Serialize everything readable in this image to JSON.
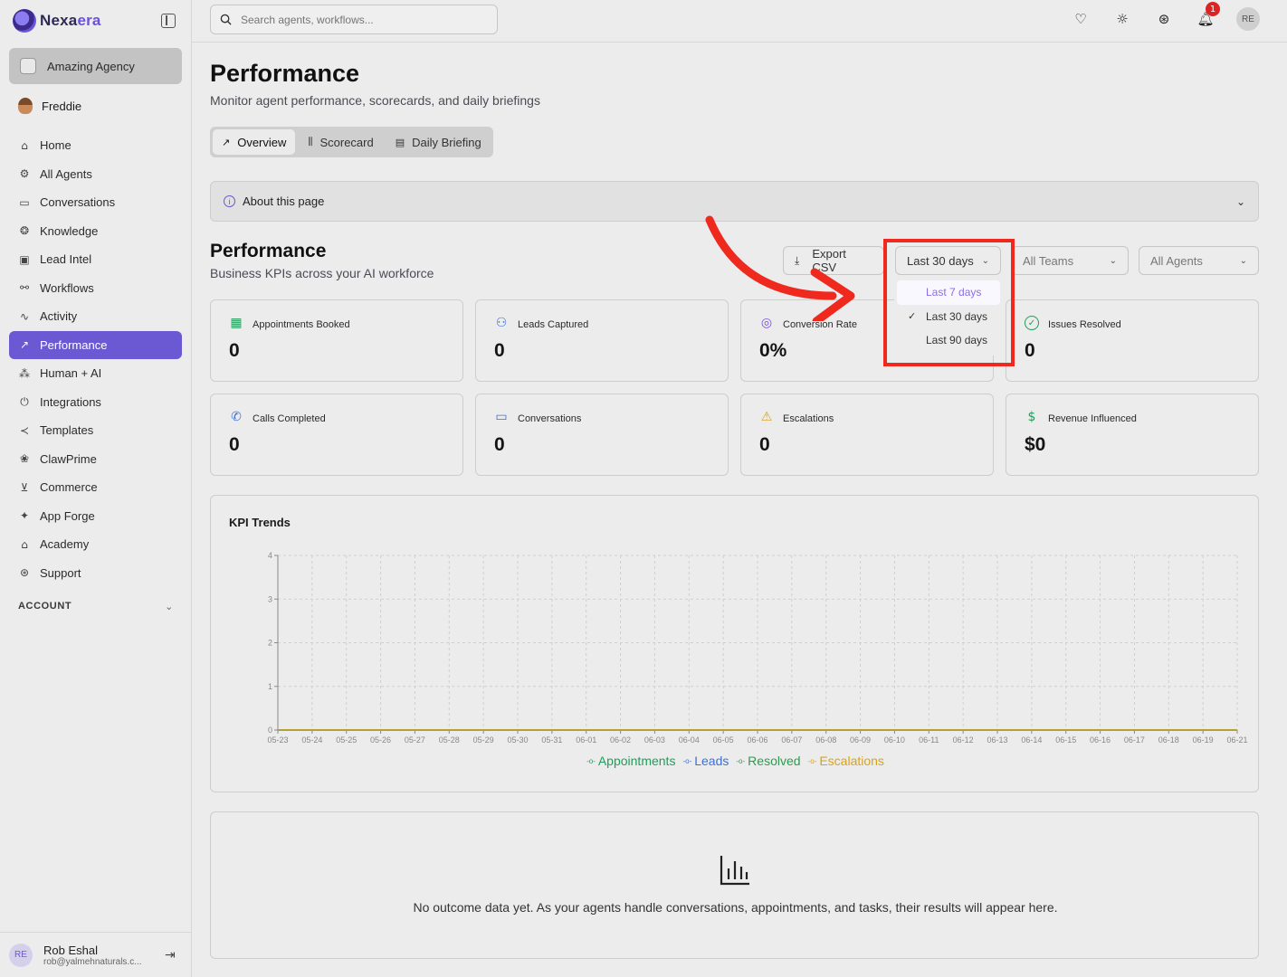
{
  "brand": {
    "name_part1": "Nexa",
    "name_part2": "era"
  },
  "org": {
    "name": "Amazing Agency"
  },
  "current_user": {
    "name": "Freddie"
  },
  "sidebar": {
    "items": [
      {
        "label": "Home",
        "icon": "home-icon",
        "glyph": "⌂"
      },
      {
        "label": "All Agents",
        "icon": "robot-icon",
        "glyph": "⚙"
      },
      {
        "label": "Conversations",
        "icon": "chat-icon",
        "glyph": "▭"
      },
      {
        "label": "Knowledge",
        "icon": "brain-icon",
        "glyph": "❂"
      },
      {
        "label": "Lead Intel",
        "icon": "contact-card-icon",
        "glyph": "▣"
      },
      {
        "label": "Workflows",
        "icon": "workflow-icon",
        "glyph": "⚯"
      },
      {
        "label": "Activity",
        "icon": "pulse-icon",
        "glyph": "∿"
      },
      {
        "label": "Performance",
        "icon": "trend-icon",
        "glyph": "↗"
      },
      {
        "label": "Human + AI",
        "icon": "network-icon",
        "glyph": "⁂"
      },
      {
        "label": "Integrations",
        "icon": "plug-icon",
        "glyph": "⏻"
      },
      {
        "label": "Templates",
        "icon": "share-icon",
        "glyph": "≺"
      },
      {
        "label": "ClawPrime",
        "icon": "paw-icon",
        "glyph": "❀"
      },
      {
        "label": "Commerce",
        "icon": "cart-icon",
        "glyph": "⊻"
      },
      {
        "label": "App Forge",
        "icon": "sparkles-icon",
        "glyph": "✦"
      },
      {
        "label": "Academy",
        "icon": "graduation-cap-icon",
        "glyph": "⌂"
      },
      {
        "label": "Support",
        "icon": "lifebuoy-icon",
        "glyph": "⊛"
      }
    ],
    "active": "Performance",
    "account_label": "ACCOUNT"
  },
  "bottom_user": {
    "initials": "RE",
    "name": "Rob Eshal",
    "email": "rob@yalmehnaturals.c..."
  },
  "topbar": {
    "search_placeholder": "Search agents, workflows...",
    "notification_count": "1",
    "avatar_initials": "RE"
  },
  "page": {
    "title": "Performance",
    "subtitle": "Monitor agent performance, scorecards, and daily briefings"
  },
  "tabs": [
    {
      "label": "Overview",
      "active": true
    },
    {
      "label": "Scorecard",
      "active": false
    },
    {
      "label": "Daily Briefing",
      "active": false
    }
  ],
  "about": {
    "label": "About this page"
  },
  "section": {
    "title": "Performance",
    "subtitle": "Business KPIs across your AI workforce"
  },
  "controls": {
    "export_label": "Export CSV",
    "range_selected": "Last 30 days",
    "teams_label": "All Teams",
    "agents_label": "All Agents"
  },
  "range_options": [
    {
      "label": "Last 7 days",
      "state": "hover"
    },
    {
      "label": "Last 30 days",
      "state": "selected"
    },
    {
      "label": "Last 90 days",
      "state": "normal"
    }
  ],
  "kpis": [
    {
      "label": "Appointments Booked",
      "value": "0",
      "icon": "calendar-check-icon",
      "color": "#1e9e5a"
    },
    {
      "label": "Leads Captured",
      "value": "0",
      "icon": "user-plus-icon",
      "color": "#3b6fd8"
    },
    {
      "label": "Conversion Rate",
      "value": "0%",
      "icon": "target-icon",
      "color": "#7a4fe0"
    },
    {
      "label": "Issues Resolved",
      "value": "0",
      "icon": "check-circle-icon",
      "color": "#1e9e5a"
    },
    {
      "label": "Calls Completed",
      "value": "0",
      "icon": "phone-icon",
      "color": "#3b6fd8"
    },
    {
      "label": "Conversations",
      "value": "0",
      "icon": "message-icon",
      "color": "#3b6fd8"
    },
    {
      "label": "Escalations",
      "value": "0",
      "icon": "warning-icon",
      "color": "#d9a21b"
    },
    {
      "label": "Revenue Influenced",
      "value": "$0",
      "icon": "dollar-icon",
      "color": "#1e9e5a"
    }
  ],
  "chart_data": {
    "type": "line",
    "title": "KPI Trends",
    "x": [
      "05-23",
      "05-24",
      "05-25",
      "05-26",
      "05-27",
      "05-28",
      "05-29",
      "05-30",
      "05-31",
      "06-01",
      "06-02",
      "06-03",
      "06-04",
      "06-05",
      "06-06",
      "06-07",
      "06-08",
      "06-09",
      "06-10",
      "06-11",
      "06-12",
      "06-13",
      "06-14",
      "06-15",
      "06-16",
      "06-17",
      "06-18",
      "06-19",
      "06-21"
    ],
    "ylim": [
      0,
      4
    ],
    "yticks": [
      "0",
      "1",
      "2",
      "3",
      "4"
    ],
    "grid": true,
    "legend_placement": "bottom",
    "series": [
      {
        "name": "Appointments",
        "color": "#1e9e5a",
        "values": [
          0,
          0,
          0,
          0,
          0,
          0,
          0,
          0,
          0,
          0,
          0,
          0,
          0,
          0,
          0,
          0,
          0,
          0,
          0,
          0,
          0,
          0,
          0,
          0,
          0,
          0,
          0,
          0,
          0
        ]
      },
      {
        "name": "Leads",
        "color": "#3b6fd8",
        "values": [
          0,
          0,
          0,
          0,
          0,
          0,
          0,
          0,
          0,
          0,
          0,
          0,
          0,
          0,
          0,
          0,
          0,
          0,
          0,
          0,
          0,
          0,
          0,
          0,
          0,
          0,
          0,
          0,
          0
        ]
      },
      {
        "name": "Resolved",
        "color": "#2e9b4f",
        "values": [
          0,
          0,
          0,
          0,
          0,
          0,
          0,
          0,
          0,
          0,
          0,
          0,
          0,
          0,
          0,
          0,
          0,
          0,
          0,
          0,
          0,
          0,
          0,
          0,
          0,
          0,
          0,
          0,
          0
        ]
      },
      {
        "name": "Escalations",
        "color": "#d9a21b",
        "values": [
          0,
          0,
          0,
          0,
          0,
          0,
          0,
          0,
          0,
          0,
          0,
          0,
          0,
          0,
          0,
          0,
          0,
          0,
          0,
          0,
          0,
          0,
          0,
          0,
          0,
          0,
          0,
          0,
          0
        ]
      }
    ]
  },
  "empty_state": {
    "message": "No outcome data yet. As your agents handle conversations, appointments, and tasks, their results will appear here.",
    "icon": "bar-chart-icon"
  },
  "annotation": {
    "highlight_color": "#f0291f"
  }
}
